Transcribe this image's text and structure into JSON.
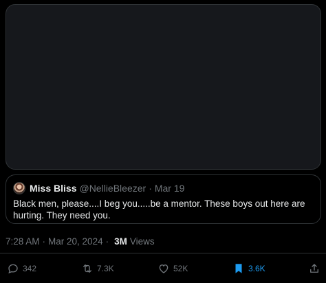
{
  "quote": {
    "name": "Miss Bliss",
    "handle": "@NellieBleezer",
    "separator": "·",
    "date": "Mar 19",
    "text": "Black men, please....I beg you.....be a mentor.  These boys out here are hurting. They need you."
  },
  "meta": {
    "time": "7:28 AM",
    "separator": "·",
    "date": "Mar 20, 2024",
    "separator2": "·",
    "views_count": "3M",
    "views_label": "Views"
  },
  "actions": {
    "reply_count": "342",
    "retweet_count": "7.3K",
    "like_count": "52K",
    "bookmark_count": "3.6K"
  },
  "colors": {
    "background": "#000000",
    "text": "#e7e9ea",
    "muted": "#71767b",
    "accent": "#1d9bf0",
    "border": "#2f3336"
  }
}
